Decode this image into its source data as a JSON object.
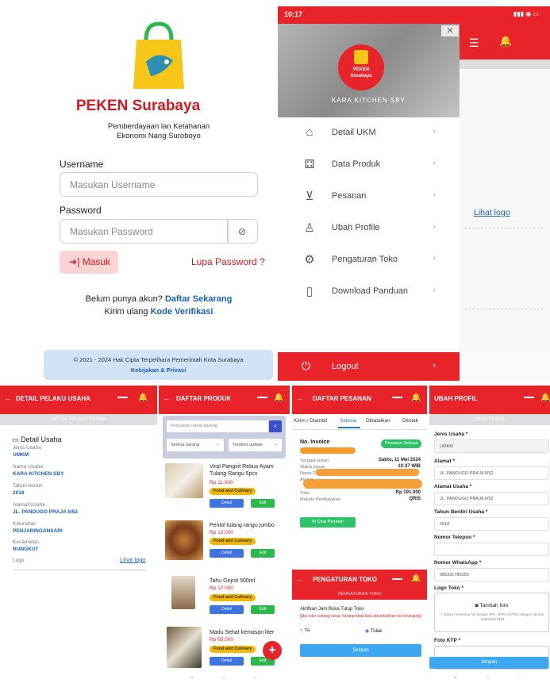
{
  "login": {
    "brand": "PEKEN Surabaya",
    "tagline_1": "Pemberdayaan lan Ketahanan",
    "tagline_2": "Ekonomi Nang Suroboyo",
    "username_label": "Username",
    "username_placeholder": "Masukan Username",
    "password_label": "Password",
    "password_placeholder": "Masukan Password",
    "login_button": "Masuk",
    "forgot": "Lupa Password ?",
    "no_account": "Belum punya akun?",
    "register": "Daftar Sekarang",
    "resend": "Kirim ulang",
    "verify_code": "Kode Verifikasi",
    "copyright": "© 2021 - 2024 Hak Cipta Terpelihara Pemerintah Kota Surabaya",
    "privacy": "Kebijakan & Privasi"
  },
  "drawer": {
    "time": "10:17",
    "logo_text_1": "PEKEN",
    "logo_text_2": "Surabaya",
    "store_name": "KARA KITCHEN SBY",
    "items": [
      {
        "label": "Detail UKM",
        "icon": "factory-icon"
      },
      {
        "label": "Data Produk",
        "icon": "boxes-icon"
      },
      {
        "label": "Pesanan",
        "icon": "cart-icon"
      },
      {
        "label": "Ubah Profile",
        "icon": "user-icon"
      },
      {
        "label": "Pengaturan Toko",
        "icon": "gear-icon"
      },
      {
        "label": "Download Panduan",
        "icon": "file-icon"
      }
    ],
    "logout": "Logout",
    "link_behind": "Lihat logo"
  },
  "detail": {
    "title": "DETAIL PELAKU USAHA",
    "subheader": "DETAIL PELAKU USAHA",
    "section": "Detail Usaha",
    "fields": [
      {
        "label": "Jenis Usaha",
        "value": "UMKM"
      },
      {
        "label": "Nama Usaha",
        "value": "KARA KITCHEN SBY"
      },
      {
        "label": "Tahun berdiri",
        "value": "2018"
      },
      {
        "label": "Alamat Usaha",
        "value": "JL. PANDUGO PRAJA II/52"
      },
      {
        "label": "Kelurahan",
        "value": "PENJARINGANSARI"
      },
      {
        "label": "Kecamatan",
        "value": "RUNGKUT"
      }
    ],
    "logo_label": "Logo",
    "logo_link": "Lihat logo"
  },
  "produk": {
    "title": "DAFTAR PRODUK",
    "search_placeholder": "Pencarian nama barang",
    "filter_1": "Semua barang",
    "filter_2": "Terakhir update",
    "detail_btn": "Detail",
    "edit_btn": "Edit",
    "items": [
      {
        "name": "Viral Pangsit Rebus Ayam Tulang Rangu 5pcs",
        "price": "Rp 11.000",
        "tag": "Food and Culinary"
      },
      {
        "name": "Pentol tulang rangu jumbo",
        "price": "Rp 13.000",
        "tag": "Food and Culinary"
      },
      {
        "name": "Tahu Gejrot 500ml",
        "price": "Rp 12.000",
        "tag": "Food and Culinary"
      },
      {
        "name": "Madu Sehat kemasan liter",
        "price": "Rp 65.000",
        "tag": "Food and Culinary"
      }
    ]
  },
  "pesanan": {
    "title": "DAFTAR PESANAN",
    "tabs": [
      "Kirim / Diambil",
      "Selesai",
      "Dibatalkan",
      "Ditolak"
    ],
    "invoice_label": "No. Invoice",
    "status": "Pesanan Selesai",
    "rows": [
      {
        "label": "Tanggal pesan",
        "value": "Sabtu, 11 Mei 2024"
      },
      {
        "label": "Waktu pesan",
        "value": "10:37 WIB"
      },
      {
        "label": "Nama Pemesan",
        "value": ""
      },
      {
        "label": "Alamat",
        "value": ""
      },
      {
        "label": "Total",
        "value": "Rp 191.000"
      },
      {
        "label": "Metode Pembayaran",
        "value": "QRIS"
      }
    ],
    "chat_button": "Chat Pembeli"
  },
  "pengaturan": {
    "title": "PENGATURAN TOKO",
    "subheader": "PENGATURAN TOKO",
    "question": "Aktifkan Jam Buka Tutup Toko",
    "note": "(jika toko sedang tutup, barang tidak bisa ditambahkan ke keranjang)",
    "opt_yes": "Ya",
    "opt_no": "Tidak",
    "save": "Simpan"
  },
  "profil": {
    "title": "UBAH PROFIL",
    "subheader": "UBAH PROFIL",
    "fields": [
      {
        "label": "Jenis Usaha *",
        "value": "UMKM"
      },
      {
        "label": "Alamat *",
        "value": "JL. PANDUGO PRAJA II/52"
      },
      {
        "label": "Alamat Usaha *",
        "value": "JL. PANDUGO PRAJA II/52"
      },
      {
        "label": "Tahun Berdiri Usaha *",
        "value": "2018"
      },
      {
        "label": "Nomor Telepon *",
        "value": ""
      },
      {
        "label": "Nomor WhatsApp *",
        "value": "085331780359"
      }
    ],
    "logo_label": "Logo Toko *",
    "add_photo": "Tambah foto",
    "photo_note": "* hanya menerima file berupa JPG, JPEG & PNG dengan ukuran maksimal 5MB",
    "ktp_label": "Foto KTP *",
    "save": "Simpan"
  },
  "colors": {
    "red": "#e8232a",
    "blue": "#1a5fb4",
    "gold": "#f5b800",
    "green": "#2db84d"
  }
}
